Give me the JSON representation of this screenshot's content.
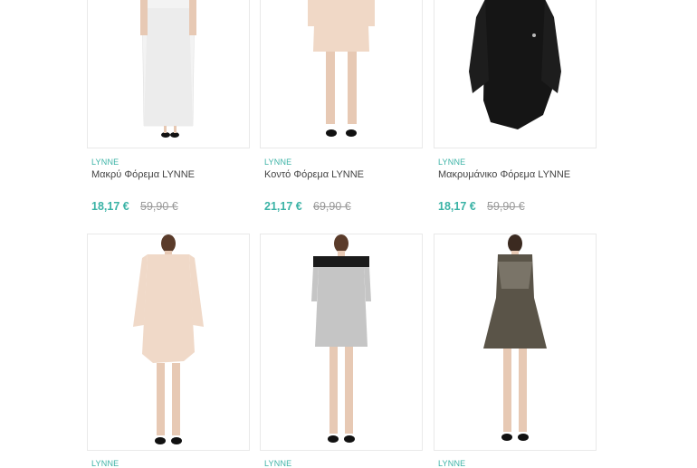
{
  "products": [
    {
      "brand": "LYNNE",
      "name": "Μακρύ Φόρεμα LYNNE",
      "price": "18,17 €",
      "old_price": "59,90 €"
    },
    {
      "brand": "LYNNE",
      "name": "Κοντό Φόρεμα LYNNE",
      "price": "21,17 €",
      "old_price": "69,90 €"
    },
    {
      "brand": "LYNNE",
      "name": "Μακρυμάνικο Φόρεμα LYNNE",
      "price": "18,17 €",
      "old_price": "59,90 €"
    },
    {
      "brand": "LYNNE"
    },
    {
      "brand": "LYNNE"
    },
    {
      "brand": "LYNNE"
    }
  ]
}
